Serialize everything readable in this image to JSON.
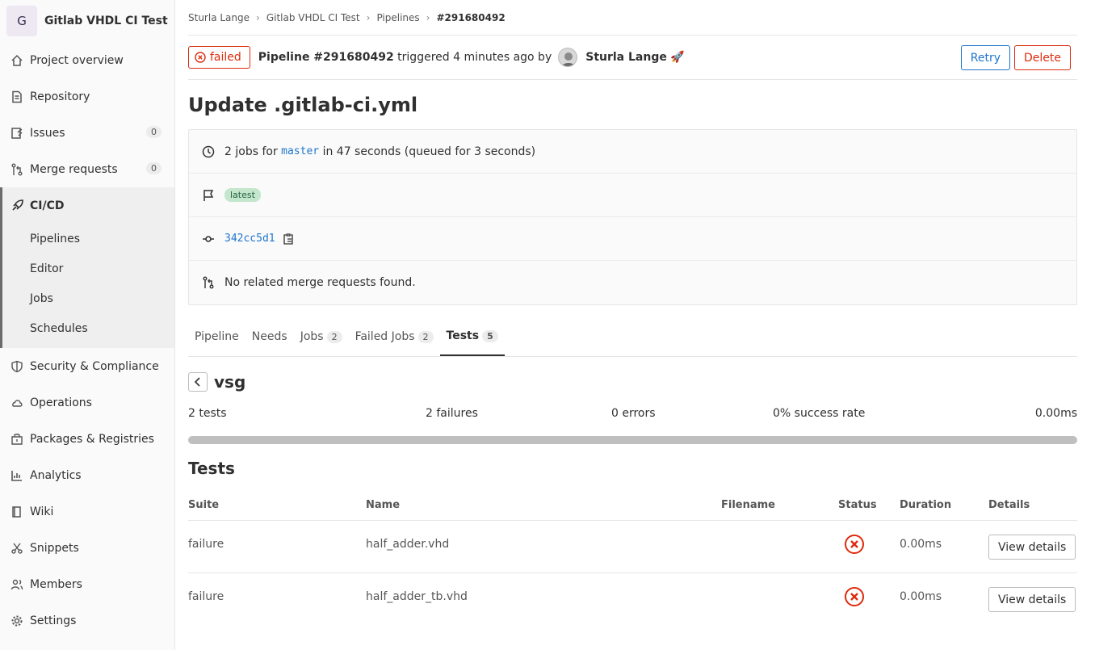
{
  "sidebar": {
    "project_initial": "G",
    "project_name": "Gitlab VHDL CI Test",
    "items": [
      {
        "label": "Project overview",
        "icon": "home-icon"
      },
      {
        "label": "Repository",
        "icon": "doc-icon"
      },
      {
        "label": "Issues",
        "icon": "issues-icon",
        "count": "0"
      },
      {
        "label": "Merge requests",
        "icon": "merge-request-icon",
        "count": "0"
      },
      {
        "label": "CI/CD",
        "icon": "rocket-icon"
      },
      {
        "label": "Security & Compliance",
        "icon": "shield-icon"
      },
      {
        "label": "Operations",
        "icon": "cloud-icon"
      },
      {
        "label": "Packages & Registries",
        "icon": "package-icon"
      },
      {
        "label": "Analytics",
        "icon": "chart-icon"
      },
      {
        "label": "Wiki",
        "icon": "book-icon"
      },
      {
        "label": "Snippets",
        "icon": "scissors-icon"
      },
      {
        "label": "Members",
        "icon": "users-icon"
      },
      {
        "label": "Settings",
        "icon": "gear-icon"
      }
    ],
    "cicd_sub": [
      "Pipelines",
      "Editor",
      "Jobs",
      "Schedules"
    ]
  },
  "breadcrumb": [
    "Sturla Lange",
    "Gitlab VHDL CI Test",
    "Pipelines",
    "#291680492"
  ],
  "header": {
    "status": "failed",
    "pipeline_label": "Pipeline #291680492",
    "triggered": "triggered 4 minutes ago by",
    "user": "Sturla Lange",
    "emoji": "🚀",
    "retry": "Retry",
    "delete": "Delete"
  },
  "title": "Update .gitlab-ci.yml",
  "info": {
    "jobs_prefix": "2 jobs for",
    "branch": "master",
    "jobs_suffix": "in 47 seconds (queued for 3 seconds)",
    "tag": "latest",
    "commit": "342cc5d1",
    "merge_requests": "No related merge requests found."
  },
  "tabs": [
    {
      "label": "Pipeline"
    },
    {
      "label": "Needs"
    },
    {
      "label": "Jobs",
      "count": "2"
    },
    {
      "label": "Failed Jobs",
      "count": "2"
    },
    {
      "label": "Tests",
      "count": "5"
    }
  ],
  "suite": {
    "name": "vsg",
    "tests": "2 tests",
    "failures": "2 failures",
    "errors": "0 errors",
    "success_rate": "0% success rate",
    "duration": "0.00ms",
    "success_fraction": 0
  },
  "tests_section": {
    "title": "Tests",
    "columns": [
      "Suite",
      "Name",
      "Filename",
      "Status",
      "Duration",
      "Details"
    ],
    "rows": [
      {
        "suite": "failure",
        "name": "half_adder.vhd",
        "filename": "",
        "status": "failed",
        "duration": "0.00ms",
        "action": "View details"
      },
      {
        "suite": "failure",
        "name": "half_adder_tb.vhd",
        "filename": "",
        "status": "failed",
        "duration": "0.00ms",
        "action": "View details"
      }
    ]
  },
  "colors": {
    "failed": "#dd2b0e",
    "link": "#1f75cb",
    "latest_bg": "#c3e6cd"
  }
}
